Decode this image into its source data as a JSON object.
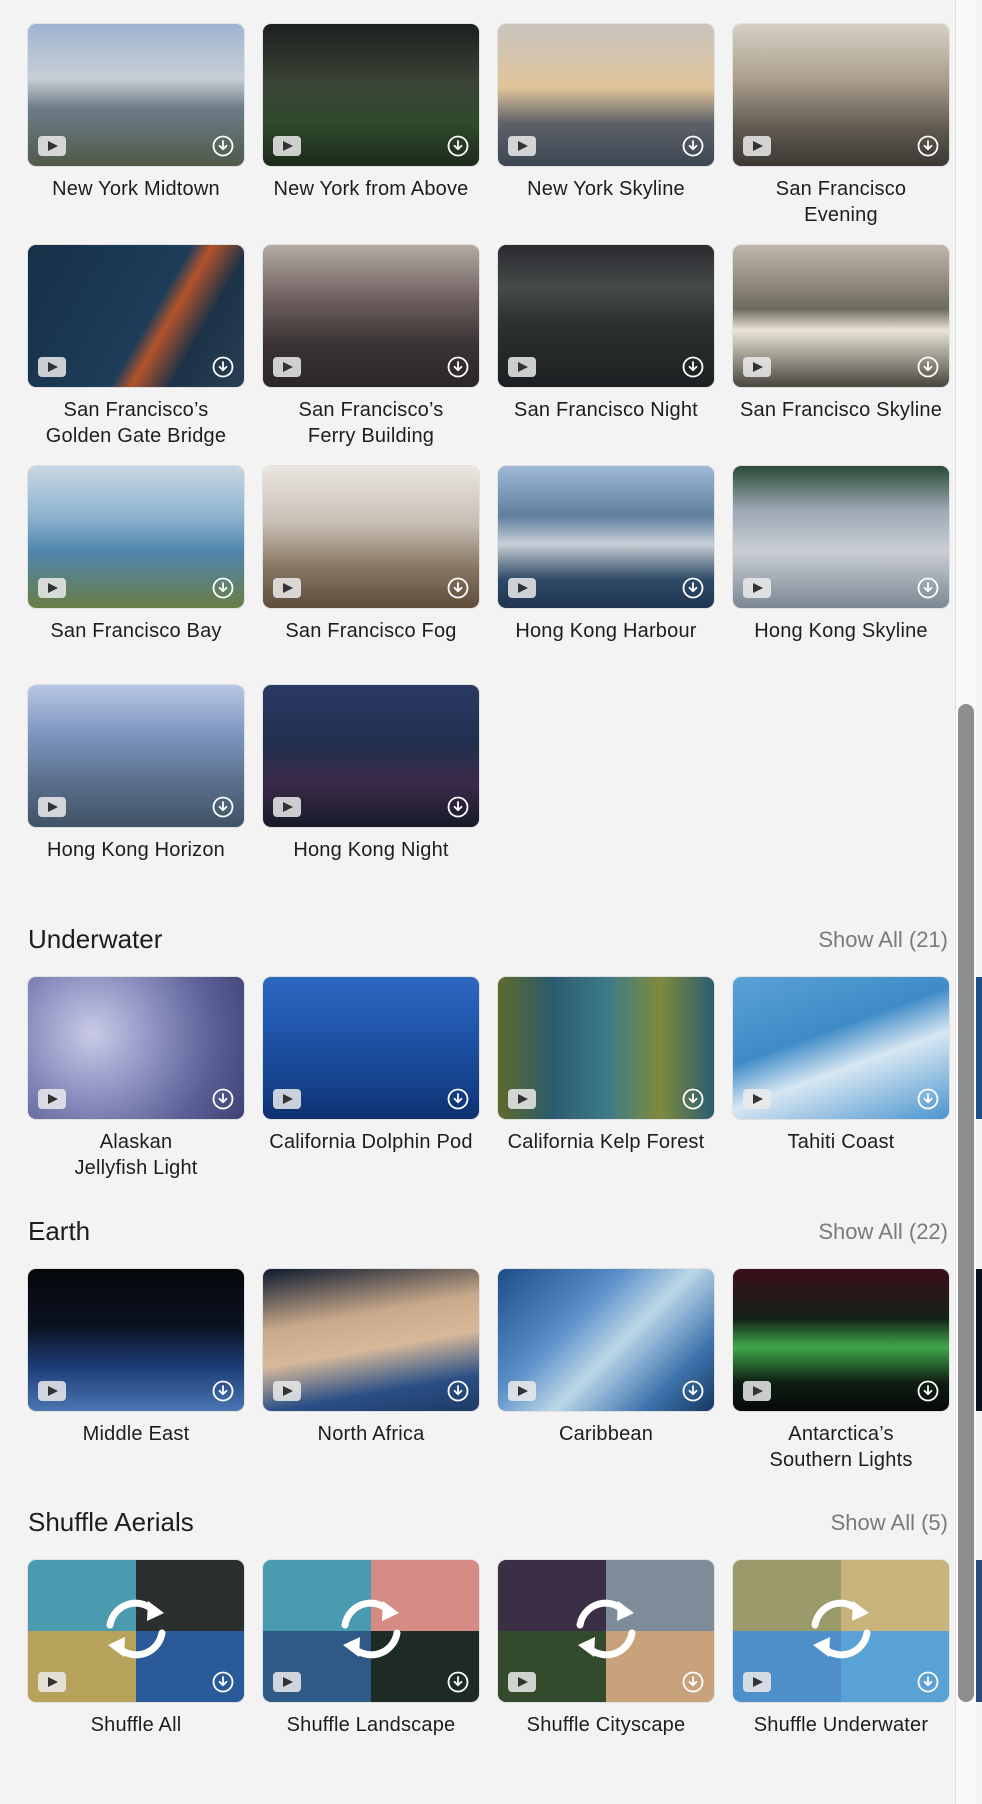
{
  "colors": {
    "background": "#f3f3f4",
    "text": "#1d1d1f",
    "secondary": "#7a7a7e",
    "scrollbar": "#8e8e90"
  },
  "cities_continued": [
    {
      "label": "New York Midtown",
      "bg": "linear-gradient(180deg,#9db3d0 0%,#c8cfd6 38%,#6c7b86 60%,#4f5a49 100%)"
    },
    {
      "label": "New York from Above",
      "bg": "linear-gradient(180deg,#1b1f1e 0%,#3a4336 40%,#2f4a2b 70%,#1d2a1b 100%)"
    },
    {
      "label": "New York Skyline",
      "bg": "linear-gradient(180deg,#c9c4be 0%,#e0c49a 45%,#5d6168 70%,#3d4653 100%)"
    },
    {
      "label": "San Francisco\nEvening",
      "bg": "linear-gradient(180deg,#d6d0c3 0%,#a99d8c 40%,#5d574e 75%,#3c3934 100%)"
    },
    {
      "label": "San Francisco’s\nGolden Gate Bridge",
      "bg": "linear-gradient(120deg,#163047 0%,#1e3d58 55%,#b4532b 62%,#1c3247 75%,#2a3f53 100%)"
    },
    {
      "label": "San Francisco’s\nFerry Building",
      "bg": "linear-gradient(180deg,#b5a9a4 0%,#6a5d5c 40%,#3a3334 70%,#2c2628 100%)"
    },
    {
      "label": "San Francisco Night",
      "bg": "linear-gradient(180deg,#2a2b2f 0%,#464a4a 30%,#2d3230 55%,#1c2022 100%)"
    },
    {
      "label": "San Francisco Skyline",
      "bg": "linear-gradient(180deg,#bfb7ab 0%,#6f6a5f 45%,#e9e4d4 60%,#47453f 100%)"
    },
    {
      "label": "San Francisco Bay",
      "bg": "linear-gradient(180deg,#c8d6e3 0%,#8fb4cf 35%,#4f86ad 60%,#6a7d45 100%)"
    },
    {
      "label": "San Francisco Fog",
      "bg": "linear-gradient(180deg,#eae6e0 0%,#c8bfb4 40%,#8b7966 70%,#5e4b3a 100%)"
    },
    {
      "label": "Hong Kong Harbour",
      "bg": "linear-gradient(180deg,#9fb9d7 0%,#5f7e9e 35%,#c8cfd6 55%,#2e4a66 80%,#1f3550 100%)"
    },
    {
      "label": "Hong Kong Skyline",
      "bg": "linear-gradient(180deg,#2a4a36 0%,#9aa6b2 30%,#c9ced3 60%,#7c8794 100%)"
    },
    {
      "label": "Hong Kong Horizon",
      "bg": "linear-gradient(180deg,#b8c7e4 0%,#7e95c0 35%,#5d7390 65%,#405265 100%)"
    },
    {
      "label": "Hong Kong Night",
      "bg": "linear-gradient(180deg,#2a3a64 0%,#21304f 40%,#3b2a48 70%,#161a2a 100%)"
    }
  ],
  "underwater": {
    "title": "Underwater",
    "show_all": "Show All (21)",
    "items": [
      {
        "label": "Alaskan\nJellyfish Light",
        "bg": "radial-gradient(circle at 30% 40%,#c9cbe6 0%,#8e93c2 35%,#5a5f95 70%,#3e4275 100%)"
      },
      {
        "label": "California Dolphin Pod",
        "bg": "linear-gradient(180deg,#2d67c0 0%,#1f54a8 40%,#143f88 80%,#0d2f6d 100%)"
      },
      {
        "label": "California Kelp Forest",
        "bg": "linear-gradient(90deg,#5d6a2a 0%,#2c5b6e 25%,#3b7a8a 50%,#7e8a3a 75%,#2a5d72 100%)"
      },
      {
        "label": "Tahiti Coast",
        "bg": "linear-gradient(160deg,#5aa2d6 0%,#3f8bc7 40%,#d7e7f2 60%,#4b95cf 100%)"
      }
    ],
    "peek_bg": "#1f4f88"
  },
  "earth": {
    "title": "Earth",
    "show_all": "Show All (22)",
    "items": [
      {
        "label": "Middle East",
        "bg": "linear-gradient(180deg,#05070c 0%,#0b1220 40%,#1e3f78 70%,#4a76b3 100%)"
      },
      {
        "label": "North Africa",
        "bg": "linear-gradient(170deg,#0d1a2f 0%,#c9a98a 35%,#d7b99a 55%,#2a4f86 80%,#1f3a66 100%)"
      },
      {
        "label": "Caribbean",
        "bg": "linear-gradient(135deg,#1e4d86 0%,#5a8fc7 35%,#bcd7e8 55%,#3d73ad 80%,#17375f 100%)"
      },
      {
        "label": "Antarctica’s\nSouthern Lights",
        "bg": "linear-gradient(180deg,#3b0f1a 0%,#132216 35%,#3ea84a 55%,#0f1d14 80%,#050a07 100%)"
      }
    ],
    "peek_bg": "#0a1220"
  },
  "shuffle": {
    "title": "Shuffle Aerials",
    "show_all": "Show All (5)",
    "items": [
      {
        "label": "Shuffle All",
        "quads": [
          "#4a9ab0",
          "#2b2f2d",
          "#b6a25a",
          "#2a5a9a"
        ]
      },
      {
        "label": "Shuffle Landscape",
        "quads": [
          "#4a9ab0",
          "#d68c84",
          "#2f5a86",
          "#1d2b24"
        ]
      },
      {
        "label": "Shuffle Cityscape",
        "quads": [
          "#3b2f45",
          "#7e8c9a",
          "#334b2c",
          "#c7a27a"
        ]
      },
      {
        "label": "Shuffle Underwater",
        "quads": [
          "#9a9a6a",
          "#c8b47a",
          "#4f8fc9",
          "#5aa2d6"
        ]
      }
    ],
    "peek_bg": "#2a4a7a"
  }
}
